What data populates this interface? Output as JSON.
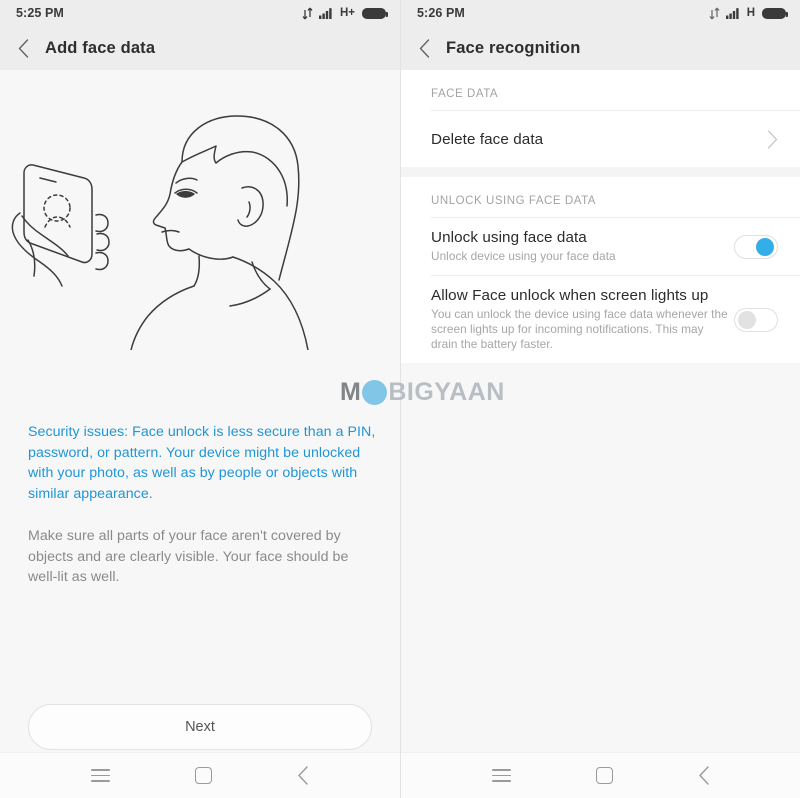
{
  "left_screen": {
    "status_bar": {
      "time": "5:25 PM",
      "network_label": "H+",
      "icons": [
        "data-transfer-icon",
        "signal-icon",
        "network-type-label",
        "battery-icon"
      ]
    },
    "app_bar": {
      "back_label": "back-icon",
      "title": "Add face data"
    },
    "illustration": {
      "name": "face-unlock-illustration",
      "description": "Hand holding a phone with a dashed face outline facing a man's head in profile"
    },
    "warning_text": "Security issues: Face unlock is less secure than a PIN, password, or pattern. Your device might be unlocked with your photo, as well as by people or objects with similar appearance.",
    "hint_text": "Make sure all parts of your face aren't covered by objects and are clearly visible. Your face should be well-lit as well.",
    "next_button": "Next",
    "colors": {
      "warning": "#2196d6",
      "hint": "#8a8a8a"
    }
  },
  "right_screen": {
    "status_bar": {
      "time": "5:26 PM",
      "network_label": "H",
      "icons": [
        "data-transfer-icon",
        "signal-icon",
        "network-type-label",
        "battery-icon"
      ]
    },
    "app_bar": {
      "back_label": "back-icon",
      "title": "Face recognition"
    },
    "sections": [
      {
        "header": "FACE DATA",
        "rows": [
          {
            "title": "Delete face data",
            "subtitle": "",
            "control": "chevron-right-icon"
          }
        ]
      },
      {
        "header": "UNLOCK USING FACE DATA",
        "rows": [
          {
            "title": "Unlock using face data",
            "subtitle": "Unlock device using your face data",
            "control": "toggle",
            "toggle_state": "on"
          },
          {
            "title": "Allow Face unlock when screen lights up",
            "subtitle": "You can unlock the device using face data whenever the screen lights up for incoming notifications. This may drain the battery faster.",
            "control": "toggle",
            "toggle_state": "off"
          }
        ]
      }
    ],
    "colors": {
      "toggle_on": "#34aee8",
      "toggle_off": "#e2e2e2"
    }
  },
  "nav_bar": {
    "menu": "menu-icon",
    "home": "home-icon",
    "back": "back-icon"
  },
  "watermark": {
    "first": "M",
    "circle": "O",
    "rest": "BIGYAAN"
  }
}
